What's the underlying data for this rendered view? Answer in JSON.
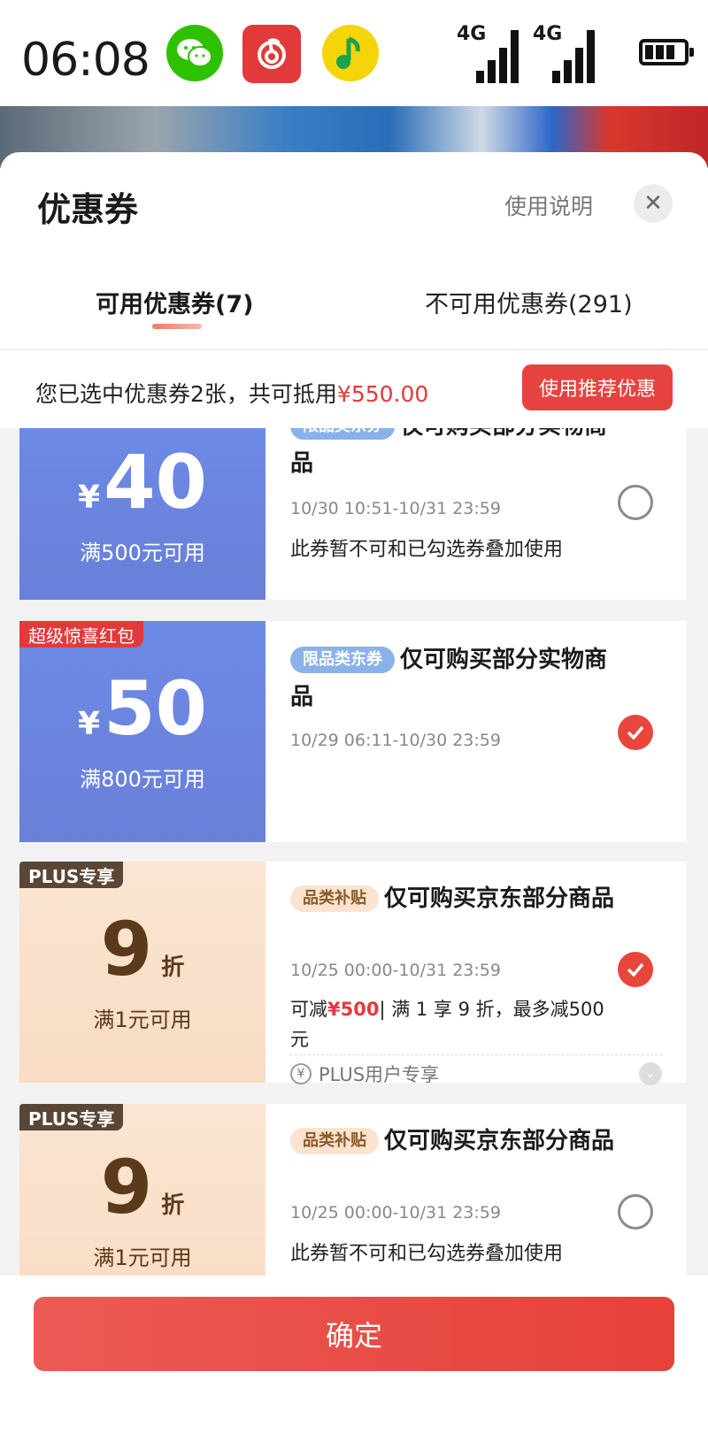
{
  "status_bar": {
    "time": "06:08",
    "apps": [
      "wechat-icon",
      "netease-music-icon",
      "qq-music-icon"
    ],
    "signal_1": "4G",
    "signal_2": "4G"
  },
  "sheet": {
    "title": "优惠券",
    "help_link": "使用说明",
    "close_icon": "close-icon"
  },
  "tabs": [
    {
      "label": "可用优惠券(7)",
      "active": true
    },
    {
      "label": "不可用优惠券(291)",
      "active": false
    }
  ],
  "summary": {
    "prefix": "您已选中优惠券2张，共可抵用",
    "amount": "¥550.00",
    "button": "使用推荐优惠"
  },
  "coupons": [
    {
      "yen": "¥",
      "value": "40",
      "condition": "满500元可用",
      "chip": "限品类东券",
      "title": "仅可购买部分实物商品",
      "date": "10/30 10:51-10/31 23:59",
      "note": "此券暂不可和已勾选券叠加使用",
      "selected": false
    },
    {
      "corner": "超级惊喜红包",
      "yen": "¥",
      "value": "50",
      "condition": "满800元可用",
      "chip": "限品类东券",
      "title": "仅可购买部分实物商品",
      "date": "10/29 06:11-10/30 23:59",
      "selected": true
    },
    {
      "corner": "PLUS专享",
      "value": "9",
      "unit": "折",
      "condition": "满1元可用",
      "chip": "品类补贴",
      "title": "仅可购买京东部分商品",
      "date": "10/25 00:00-10/31 23:59",
      "note_prefix": "可减",
      "note_amount": "¥500",
      "note_suffix": "| 满 1 享 9 折，最多减500元",
      "plus_label": "PLUS用户专享",
      "selected": true
    },
    {
      "corner": "PLUS专享",
      "value": "9",
      "unit": "折",
      "condition": "满1元可用",
      "chip": "品类补贴",
      "title": "仅可购买京东部分商品",
      "date": "10/25 00:00-10/31 23:59",
      "note": "此券暂不可和已勾选券叠加使用",
      "selected": false
    }
  ],
  "footer": {
    "confirm": "确定"
  }
}
